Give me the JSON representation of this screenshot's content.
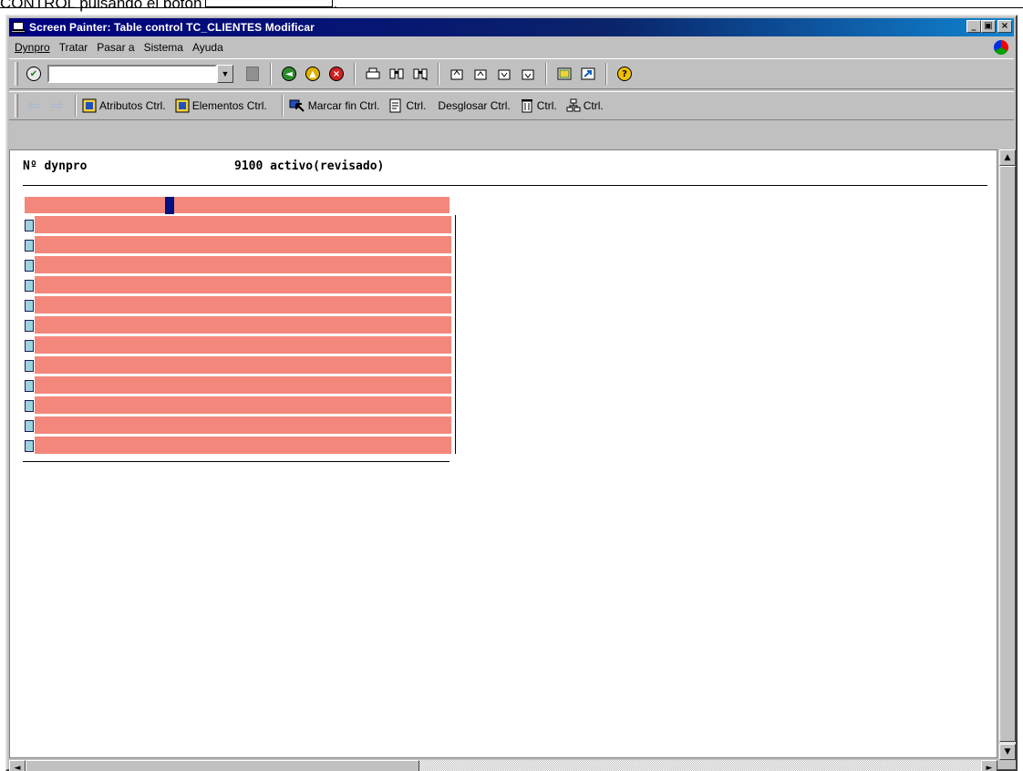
{
  "document": {
    "top_text": "CONTROL pulsando el botón",
    "top_suffix": "."
  },
  "window": {
    "title": "Screen Painter: Table control TC_CLIENTES Modificar",
    "controls": {
      "minimize": "_",
      "maximize": "▣",
      "close": "×"
    }
  },
  "menu": {
    "items": [
      {
        "label": "Dynpro"
      },
      {
        "label": "Tratar"
      },
      {
        "label": "Pasar a"
      },
      {
        "label": "Sistema"
      },
      {
        "label": "Ayuda"
      }
    ]
  },
  "toolbar1": {
    "command_field_value": "",
    "colors": {
      "ok": "#2c7c2c",
      "back": "#2c8c2c",
      "exit": "#e0b000",
      "cancel": "#d02020"
    }
  },
  "toolbar2": {
    "items": [
      {
        "label": "Atributos Ctrl."
      },
      {
        "label": "Elementos Ctrl."
      },
      {
        "label": "Marcar fin Ctrl."
      },
      {
        "label": "Ctrl."
      },
      {
        "label": "Desglosar Ctrl."
      },
      {
        "label": "Ctrl."
      },
      {
        "label": "Ctrl."
      }
    ]
  },
  "header": {
    "dynpro_label": "Nº dynpro",
    "dynpro_value": "9100 activo(revisado)"
  },
  "table_control": {
    "row_count": 12,
    "color": "#f4877c"
  }
}
